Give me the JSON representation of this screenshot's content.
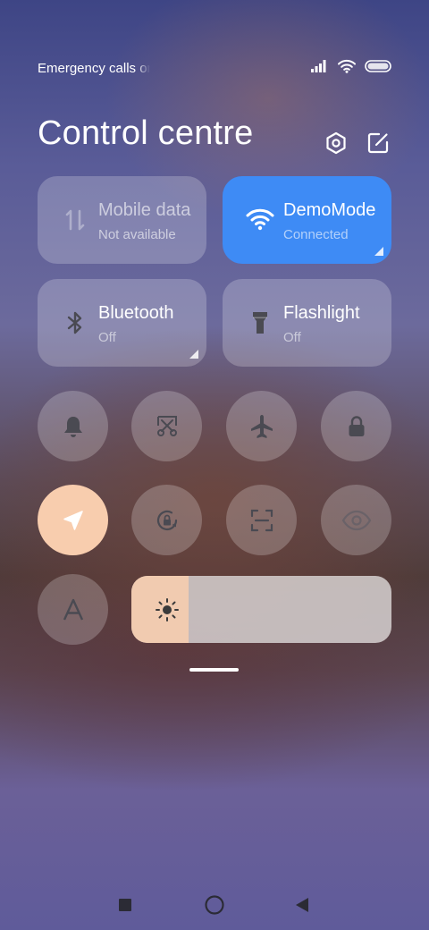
{
  "status_bar": {
    "carrier_text": "Emergency calls only",
    "icons": [
      "signal-icon",
      "wifi-icon",
      "battery-icon"
    ]
  },
  "header": {
    "title": "Control centre",
    "settings_icon": "settings-icon",
    "edit_icon": "edit-icon"
  },
  "tiles": [
    {
      "name": "mobile-data",
      "label": "Mobile data",
      "status": "Not available",
      "icon": "mobile-data-icon",
      "active": false
    },
    {
      "name": "wifi",
      "label": "DemoMode",
      "status": "Connected",
      "icon": "wifi-icon",
      "active": true
    },
    {
      "name": "bluetooth",
      "label": "Bluetooth",
      "status": "Off",
      "icon": "bluetooth-icon",
      "active": false
    },
    {
      "name": "flashlight",
      "label": "Flashlight",
      "status": "Off",
      "icon": "flashlight-icon",
      "active": false
    }
  ],
  "toggles_row1": [
    {
      "name": "silent",
      "icon": "bell-icon",
      "active": false
    },
    {
      "name": "screenshot",
      "icon": "scissors-icon",
      "active": false
    },
    {
      "name": "airplane-mode",
      "icon": "airplane-icon",
      "active": false
    },
    {
      "name": "lock-screen",
      "icon": "lock-icon",
      "active": false
    }
  ],
  "toggles_row2": [
    {
      "name": "location",
      "icon": "location-arrow-icon",
      "active": true
    },
    {
      "name": "rotation-lock",
      "icon": "rotation-lock-icon",
      "active": false
    },
    {
      "name": "scanner",
      "icon": "scan-icon",
      "active": false
    },
    {
      "name": "reading-mode",
      "icon": "eye-icon",
      "active": false
    }
  ],
  "auto_brightness": {
    "icon": "auto-brightness-icon",
    "label": "A",
    "active": false
  },
  "brightness": {
    "level": 0.22,
    "icon": "sun-icon"
  },
  "colors": {
    "active_blue": "#3e8bf5",
    "active_peach": "#f8cdae",
    "brightness_fill": "#f1cbb0"
  },
  "nav_bar": [
    "recents-icon",
    "home-icon",
    "back-icon"
  ]
}
